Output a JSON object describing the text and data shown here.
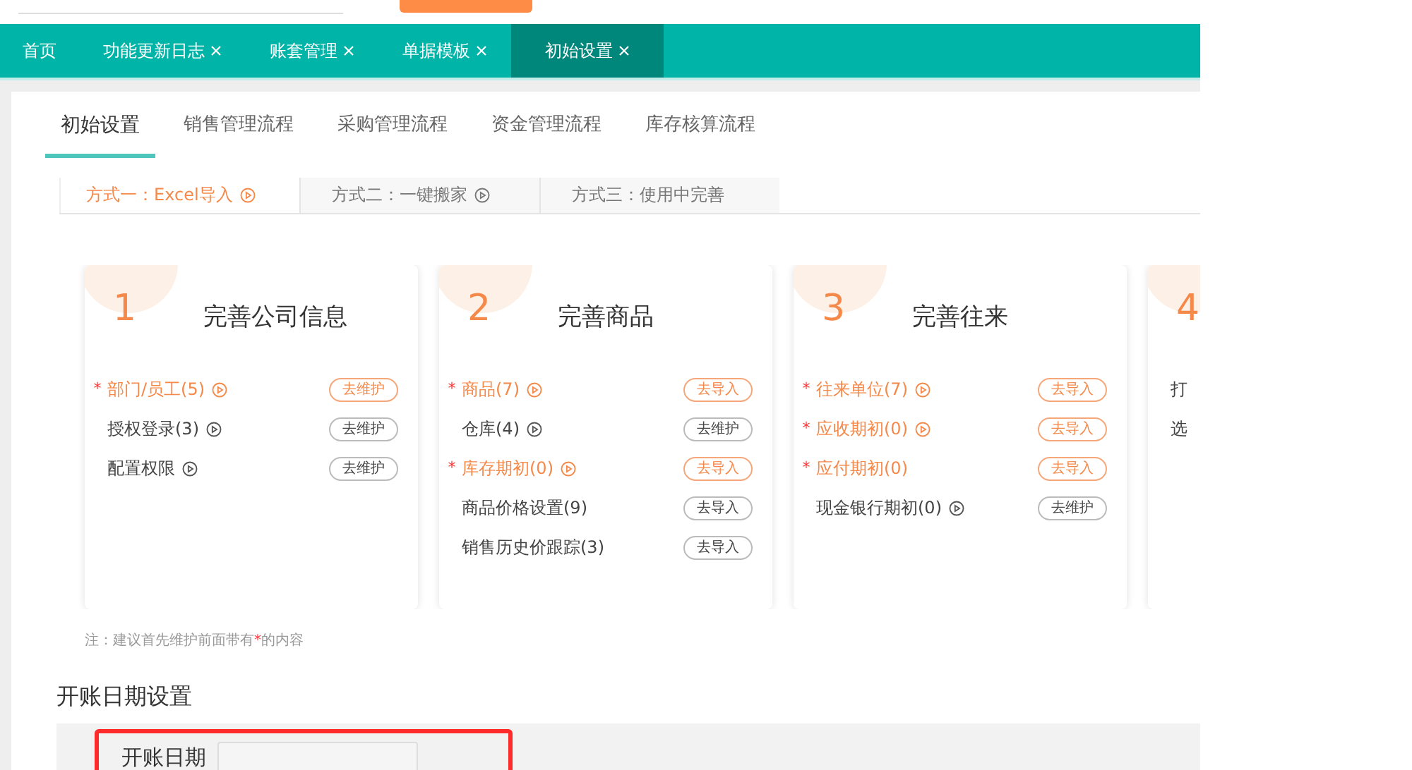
{
  "nav_tabs": [
    {
      "label": "首页",
      "closable": false,
      "selected": false
    },
    {
      "label": "功能更新日志",
      "closable": true,
      "selected": false
    },
    {
      "label": "账套管理",
      "closable": true,
      "selected": false
    },
    {
      "label": "单据模板",
      "closable": true,
      "selected": false
    },
    {
      "label": "初始设置",
      "closable": true,
      "selected": true
    }
  ],
  "sub_tabs": [
    {
      "label": "初始设置",
      "selected": true
    },
    {
      "label": "销售管理流程",
      "selected": false
    },
    {
      "label": "采购管理流程",
      "selected": false
    },
    {
      "label": "资金管理流程",
      "selected": false
    },
    {
      "label": "库存核算流程",
      "selected": false
    }
  ],
  "method_tabs": [
    {
      "label": "方式一：Excel导入",
      "video": true,
      "selected": true
    },
    {
      "label": "方式二：一键搬家",
      "video": true,
      "selected": false
    },
    {
      "label": "方式三：使用中完善",
      "video": false,
      "selected": false
    }
  ],
  "cards": [
    {
      "number": "1",
      "title": "完善公司信息",
      "items": [
        {
          "label": "部门/员工(5)",
          "required": true,
          "video": true,
          "button": "去维护"
        },
        {
          "label": "授权登录(3)",
          "required": false,
          "video": true,
          "button": "去维护"
        },
        {
          "label": "配置权限",
          "required": false,
          "video": true,
          "button": "去维护"
        }
      ]
    },
    {
      "number": "2",
      "title": "完善商品",
      "items": [
        {
          "label": "商品(7)",
          "required": true,
          "video": true,
          "button": "去导入"
        },
        {
          "label": "仓库(4)",
          "required": false,
          "video": true,
          "button": "去维护"
        },
        {
          "label": "库存期初(0)",
          "required": true,
          "video": true,
          "button": "去导入"
        },
        {
          "label": "商品价格设置(9)",
          "required": false,
          "video": false,
          "button": "去导入"
        },
        {
          "label": "销售历史价跟踪(3)",
          "required": false,
          "video": false,
          "button": "去导入"
        }
      ]
    },
    {
      "number": "3",
      "title": "完善往来",
      "items": [
        {
          "label": "往来单位(7)",
          "required": true,
          "video": true,
          "button": "去导入"
        },
        {
          "label": "应收期初(0)",
          "required": true,
          "video": true,
          "button": "去导入"
        },
        {
          "label": "应付期初(0)",
          "required": true,
          "video": false,
          "button": "去导入"
        },
        {
          "label": "现金银行期初(0)",
          "required": false,
          "video": true,
          "button": "去维护"
        }
      ]
    },
    {
      "number": "4",
      "items": [
        {
          "label": "打",
          "required": false,
          "video": false
        },
        {
          "label": "选",
          "required": false,
          "video": false
        }
      ]
    }
  ],
  "note": {
    "before": "注：建议首先维护前面带有",
    "mark": "*",
    "after": "的内容"
  },
  "section_title": "开账日期设置",
  "date_setting": {
    "label": "开账日期",
    "highlighted": true
  }
}
